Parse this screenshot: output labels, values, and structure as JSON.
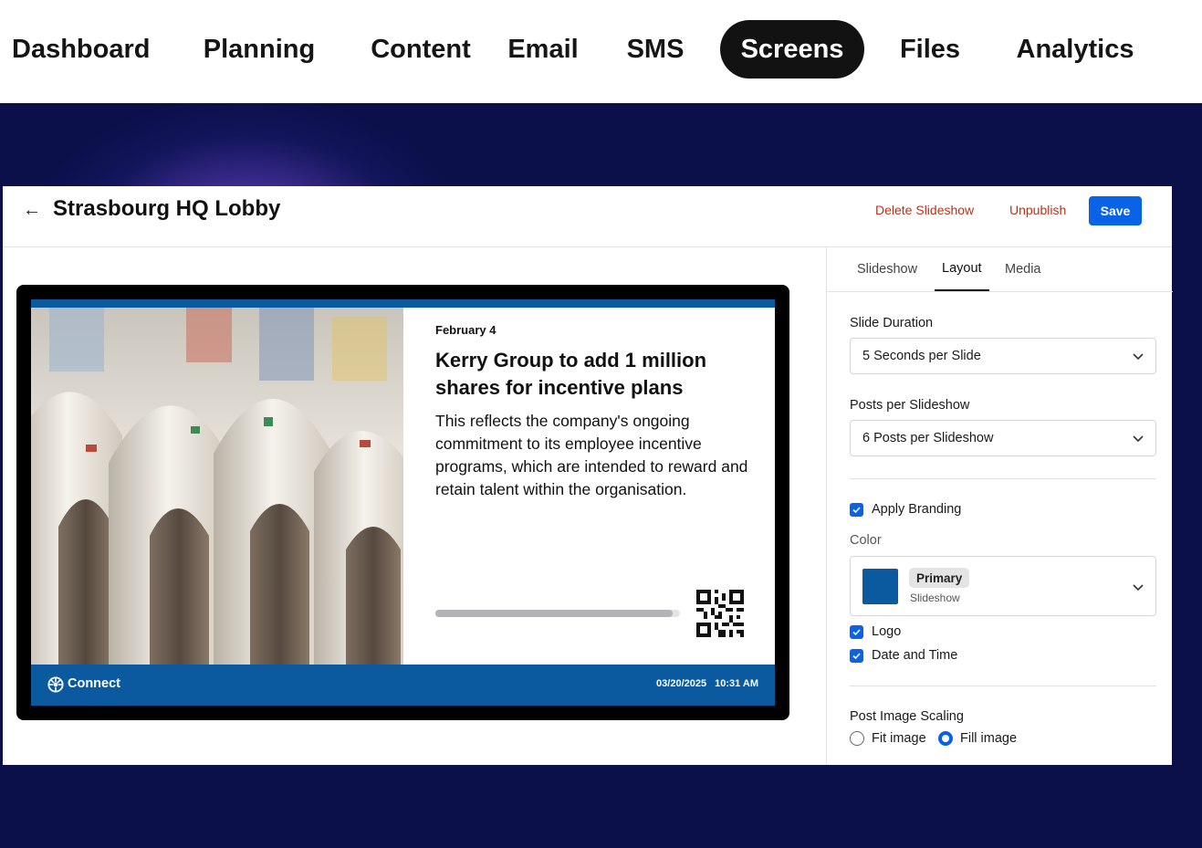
{
  "nav": {
    "items": [
      {
        "label": "Dashboard",
        "active": false
      },
      {
        "label": "Planning",
        "active": false
      },
      {
        "label": "Content",
        "active": false
      },
      {
        "label": "Email",
        "active": false
      },
      {
        "label": "SMS",
        "active": false
      },
      {
        "label": "Screens",
        "active": true
      },
      {
        "label": "Files",
        "active": false
      },
      {
        "label": "Analytics",
        "active": false
      }
    ]
  },
  "header": {
    "back_icon": "arrow-left-icon",
    "title": "Strasbourg HQ Lobby",
    "delete_label": "Delete Slideshow",
    "unpublish_label": "Unpublish",
    "save_label": "Save"
  },
  "preview": {
    "date": "February 4",
    "headline": "Kerry Group to add 1 million shares for incentive plans",
    "body": "This reflects the company's ongoing commitment to its employee incentive programs, which are intended to reward and retain talent within the organisation.",
    "progress": 0.97,
    "brand_name": "Connect",
    "footer_date": "03/20/2025",
    "footer_time": "10:31 AM",
    "brand_color": "#0b5aa0"
  },
  "sidebar": {
    "tabs": [
      {
        "label": "Slideshow",
        "active": false
      },
      {
        "label": "Layout",
        "active": true
      },
      {
        "label": "Media",
        "active": false
      }
    ],
    "slide_duration": {
      "label": "Slide Duration",
      "value": "5 Seconds per Slide"
    },
    "posts_per_slideshow": {
      "label": "Posts per Slideshow",
      "value": "6 Posts per Slideshow"
    },
    "apply_branding": {
      "label": "Apply Branding",
      "checked": true
    },
    "color": {
      "label": "Color",
      "name": "Primary",
      "source": "Slideshow",
      "hex": "#0b5aa0"
    },
    "logo": {
      "label": "Logo",
      "checked": true
    },
    "date_and_time": {
      "label": "Date and Time",
      "checked": true
    },
    "image_scaling": {
      "label": "Post Image Scaling",
      "options": [
        {
          "label": "Fit image",
          "selected": false
        },
        {
          "label": "Fill image",
          "selected": true
        }
      ]
    }
  }
}
